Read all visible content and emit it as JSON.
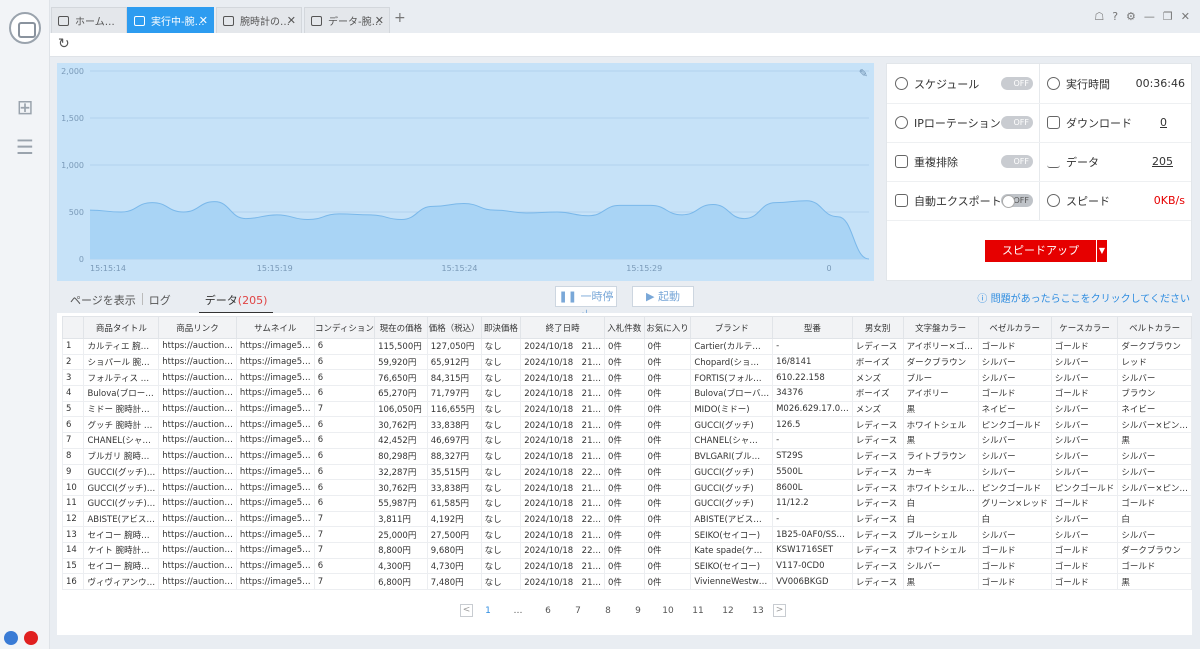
{
  "tabs": [
    {
      "label": "ホーム…",
      "active": false,
      "closable": false
    },
    {
      "label": "実行中-腕…",
      "active": true,
      "closable": true
    },
    {
      "label": "腕時計の…",
      "active": false,
      "closable": true
    },
    {
      "label": "データ-腕…",
      "active": false,
      "closable": true
    }
  ],
  "chart_data": {
    "type": "area",
    "x_ticks": [
      "15:15:14",
      "15:15:19",
      "15:15:24",
      "15:15:29",
      "0"
    ],
    "y_ticks": [
      "0",
      "500",
      "1,000",
      "1,500",
      "2,000"
    ],
    "ylim": [
      0,
      2000
    ],
    "grid": true,
    "values": [
      520,
      500,
      600,
      500,
      610,
      430,
      470,
      420,
      480,
      470,
      420,
      560,
      590,
      520,
      490,
      500,
      460,
      570,
      570,
      470,
      580,
      430,
      600,
      620,
      450,
      0
    ]
  },
  "stats": {
    "schedule": {
      "label": "スケジュール",
      "toggle": "OFF"
    },
    "runtime": {
      "label": "実行時間",
      "value": "00:36:46"
    },
    "ip": {
      "label": "IPローテーション",
      "toggle": "OFF"
    },
    "download": {
      "label": "ダウンロード",
      "value": "0"
    },
    "dedupe": {
      "label": "重複排除",
      "toggle": "OFF"
    },
    "data": {
      "label": "データ",
      "value": "205"
    },
    "autoexport": {
      "label": "自動エクスポート",
      "toggle": "OFF"
    },
    "speed": {
      "label": "スピード",
      "value": "0KB/s"
    },
    "speedup_label": "スピードアップ"
  },
  "subtabs": {
    "show_page": "ページを表示",
    "log": "ログ",
    "data": "データ",
    "data_count": "(205)"
  },
  "buttons": {
    "pause": "一時停止",
    "start": "起動"
  },
  "help_text": "問題があったらここをクリックしてください",
  "table": {
    "headers": [
      "",
      "商品タイトル",
      "商品リンク",
      "サムネイル",
      "コンディション",
      "現在の価格",
      "価格（税込）",
      "即決価格",
      "終了日時",
      "入札件数",
      "お気に入り",
      "ブランド",
      "型番",
      "男女別",
      "文字盤カラー",
      "ベゼルカラー",
      "ケースカラー",
      "ベルトカラー"
    ],
    "rows": [
      [
        "1",
        "カルティエ 腕…",
        "https://auction…",
        "https://image5…",
        "6",
        "115,500円",
        "127,050円",
        "なし",
        "2024/10/18　21…",
        "0件",
        "0件",
        "Cartier(カルテ…",
        "-",
        "レディース",
        "アイボリー×ゴ…",
        "ゴールド",
        "ゴールド",
        "ダークブラウン"
      ],
      [
        "2",
        "ショパール 腕…",
        "https://auction…",
        "https://image5…",
        "6",
        "59,920円",
        "65,912円",
        "なし",
        "2024/10/18　21…",
        "0件",
        "0件",
        "Chopard(ショ…",
        "16/8141",
        "ボーイズ",
        "ダークブラウン",
        "シルバー",
        "シルバー",
        "レッド"
      ],
      [
        "3",
        "フォルティス …",
        "https://auction…",
        "https://image5…",
        "6",
        "76,650円",
        "84,315円",
        "なし",
        "2024/10/18　21…",
        "0件",
        "0件",
        "FORTIS(フォル…",
        "610.22.158",
        "メンズ",
        "ブルー",
        "シルバー",
        "シルバー",
        "シルバー"
      ],
      [
        "4",
        "Bulova(ブロー…",
        "https://auction…",
        "https://image5…",
        "6",
        "65,270円",
        "71,797円",
        "なし",
        "2024/10/18　21…",
        "0件",
        "0件",
        "Bulova(ブローバ…",
        "34376",
        "ボーイズ",
        "アイボリー",
        "ゴールド",
        "ゴールド",
        "ブラウン"
      ],
      [
        "5",
        "ミドー 腕時計…",
        "https://auction…",
        "https://image5…",
        "7",
        "106,050円",
        "116,655円",
        "なし",
        "2024/10/18　21…",
        "0件",
        "0件",
        "MIDO(ミドー)",
        "M026.629.17.0…",
        "メンズ",
        "黒",
        "ネイビー",
        "シルバー",
        "ネイビー"
      ],
      [
        "6",
        "グッチ 腕時計 …",
        "https://auction…",
        "https://image5…",
        "6",
        "30,762円",
        "33,838円",
        "なし",
        "2024/10/18　21…",
        "0件",
        "0件",
        "GUCCI(グッチ)",
        "126.5",
        "レディース",
        "ホワイトシェル",
        "ピンクゴールド",
        "シルバー",
        "シルバー×ピン…"
      ],
      [
        "7",
        "CHANEL(シャ…",
        "https://auction…",
        "https://image5…",
        "6",
        "42,452円",
        "46,697円",
        "なし",
        "2024/10/18　21…",
        "0件",
        "0件",
        "CHANEL(シャ…",
        "-",
        "レディース",
        "黒",
        "シルバー",
        "シルバー",
        "黒"
      ],
      [
        "8",
        "ブルガリ 腕時…",
        "https://auction…",
        "https://image5…",
        "6",
        "80,298円",
        "88,327円",
        "なし",
        "2024/10/18　21…",
        "0件",
        "0件",
        "BVLGARI(ブル…",
        "ST29S",
        "レディース",
        "ライトブラウン",
        "シルバー",
        "シルバー",
        "シルバー"
      ],
      [
        "9",
        "GUCCI(グッチ)…",
        "https://auction…",
        "https://image5…",
        "6",
        "32,287円",
        "35,515円",
        "なし",
        "2024/10/18　22…",
        "0件",
        "0件",
        "GUCCI(グッチ)",
        "5500L",
        "レディース",
        "カーキ",
        "シルバー",
        "シルバー",
        "シルバー"
      ],
      [
        "10",
        "GUCCI(グッチ)…",
        "https://auction…",
        "https://image5…",
        "6",
        "30,762円",
        "33,838円",
        "なし",
        "2024/10/18　21…",
        "0件",
        "0件",
        "GUCCI(グッチ)",
        "8600L",
        "レディース",
        "ホワイトシェル…",
        "ピンクゴールド",
        "ピンクゴールド",
        "シルバー×ピン…"
      ],
      [
        "11",
        "GUCCI(グッチ)…",
        "https://auction…",
        "https://image5…",
        "6",
        "55,987円",
        "61,585円",
        "なし",
        "2024/10/18　21…",
        "0件",
        "0件",
        "GUCCI(グッチ)",
        "11/12.2",
        "レディース",
        "白",
        "グリーン×レッド",
        "ゴールド",
        "ゴールド"
      ],
      [
        "12",
        "ABISTE(アビス…",
        "https://auction…",
        "https://image5…",
        "7",
        "3,811円",
        "4,192円",
        "なし",
        "2024/10/18　22…",
        "0件",
        "0件",
        "ABISTE(アビス…",
        "-",
        "レディース",
        "白",
        "白",
        "シルバー",
        "白"
      ],
      [
        "13",
        "セイコー 腕時…",
        "https://auction…",
        "https://image5…",
        "7",
        "25,000円",
        "27,500円",
        "なし",
        "2024/10/18　21…",
        "0件",
        "0件",
        "SEIKO(セイコー)",
        "1B25-0AF0/SS…",
        "レディース",
        "ブルーシェル",
        "シルバー",
        "シルバー",
        "シルバー"
      ],
      [
        "14",
        "ケイト 腕時計…",
        "https://auction…",
        "https://image5…",
        "7",
        "8,800円",
        "9,680円",
        "なし",
        "2024/10/18　22…",
        "0件",
        "0件",
        "Kate spade(ケ…",
        "KSW1716SET",
        "レディース",
        "ホワイトシェル",
        "ゴールド",
        "ゴールド",
        "ダークブラウン"
      ],
      [
        "15",
        "セイコー 腕時…",
        "https://auction…",
        "https://image5…",
        "6",
        "4,300円",
        "4,730円",
        "なし",
        "2024/10/18　21…",
        "0件",
        "0件",
        "SEIKO(セイコー)",
        "V117-0CD0",
        "レディース",
        "シルバー",
        "ゴールド",
        "ゴールド",
        "ゴールド"
      ],
      [
        "16",
        "ヴィヴィアンウ…",
        "https://auction…",
        "https://image5…",
        "7",
        "6,800円",
        "7,480円",
        "なし",
        "2024/10/18　21…",
        "0件",
        "0件",
        "VivienneWestw…",
        "VV006BKGD",
        "レディース",
        "黒",
        "ゴールド",
        "ゴールド",
        "黒"
      ]
    ]
  },
  "pager": {
    "prev": "<",
    "pages": [
      "1",
      "…",
      "6",
      "7",
      "8",
      "9",
      "10",
      "11",
      "12",
      "13"
    ],
    "next": ">",
    "current": "1"
  },
  "colors": {
    "accent": "#2d9cf0",
    "speedup": "#e60000",
    "chart_fill": "#a9d4f5",
    "chart_bg": "#c6e2f8"
  }
}
